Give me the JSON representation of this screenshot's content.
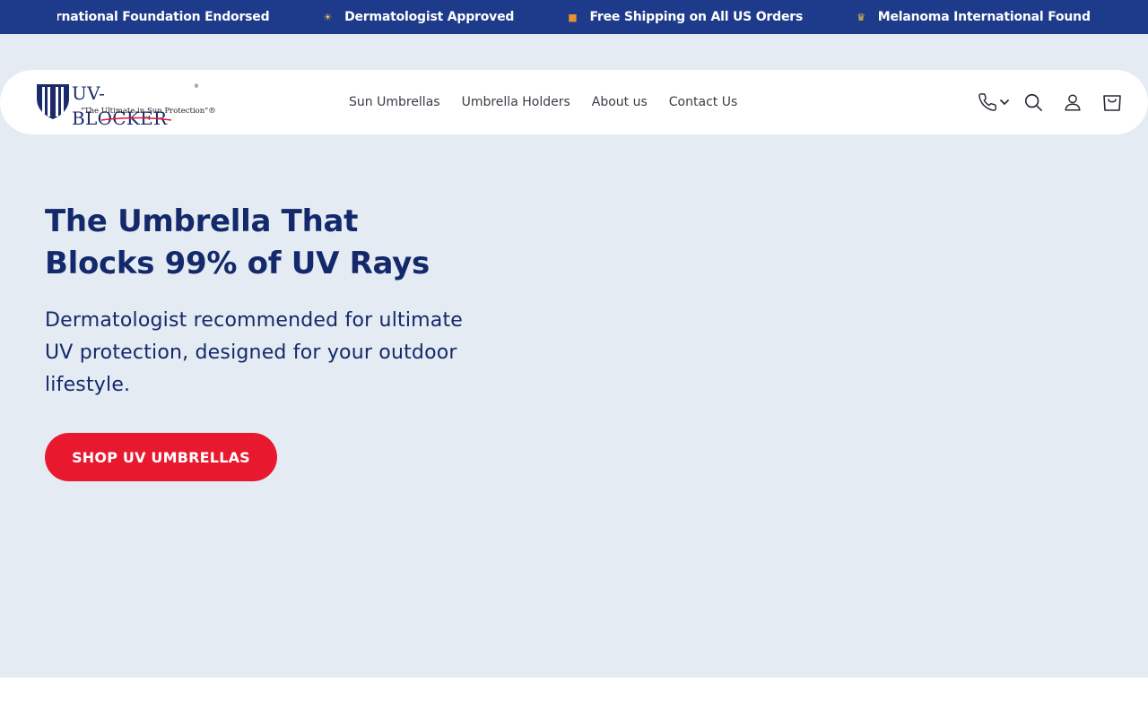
{
  "announcements": [
    {
      "emoji": "",
      "text": "ternational Foundation Endorsed"
    },
    {
      "emoji": "☀",
      "text": "Dermatologist Approved"
    },
    {
      "emoji": "■",
      "text": "Free Shipping on All US Orders"
    },
    {
      "emoji": "♛",
      "text": "Melanoma International Foundation Endorsed"
    }
  ],
  "logo": {
    "brand": "UV-BLOCKER",
    "reg": "®",
    "tagline": "\"The Ultimate in Sun Protection\"®"
  },
  "nav": {
    "items": [
      "Sun Umbrellas",
      "Umbrella Holders",
      "About us",
      "Contact Us"
    ]
  },
  "hero": {
    "title_line1": "The Umbrella That",
    "title_line2": "Blocks 99% of UV Rays",
    "subtitle": "Dermatologist recommended for ultimate UV protection, designed for your outdoor lifestyle.",
    "cta_label": "SHOP UV UMBRELLAS"
  },
  "colors": {
    "announcement_bg": "#1e3a8a",
    "hero_bg": "#e4ebf2",
    "brand_navy": "#13296b",
    "cta_red": "#e8192f"
  },
  "icons": [
    "phone-icon",
    "chevron-down-icon",
    "search-icon",
    "account-icon",
    "cart-icon"
  ]
}
